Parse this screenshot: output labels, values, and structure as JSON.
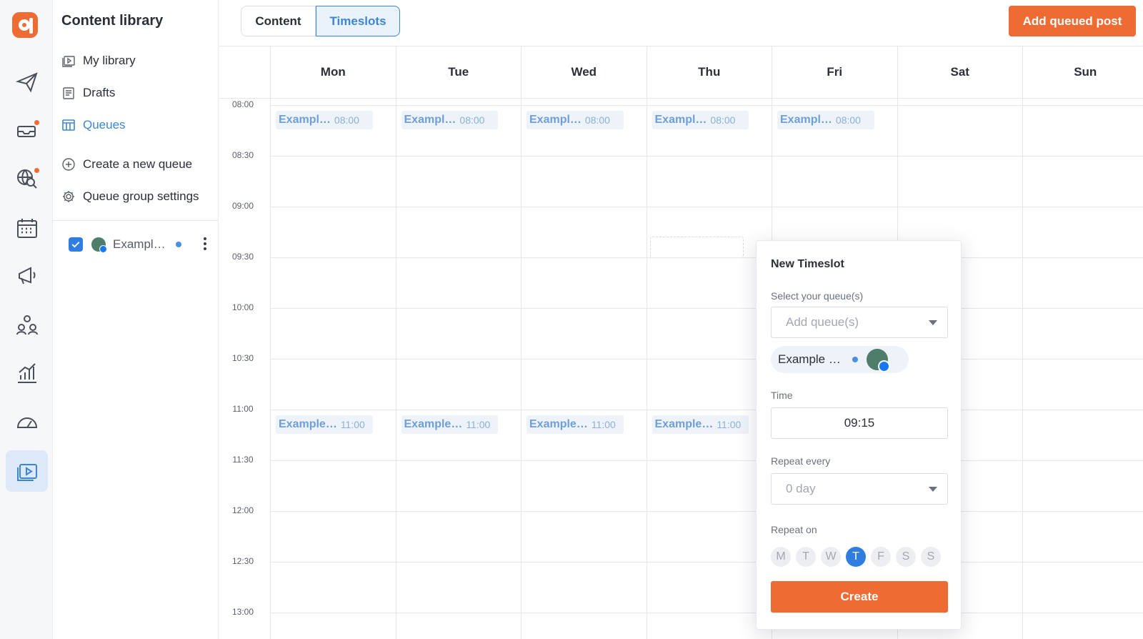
{
  "rail": {
    "icons": [
      "logo-icon",
      "paper-plane-icon",
      "inbox-icon",
      "globe-search-icon",
      "calendar-icon",
      "megaphone-icon",
      "people-icon",
      "analytics-icon",
      "speedometer-icon",
      "content-library-icon"
    ],
    "active": "content-library-icon",
    "accent": "#ee6c34"
  },
  "sidebar": {
    "title": "Content library",
    "items": [
      {
        "label": "My library",
        "icon": "library-icon"
      },
      {
        "label": "Drafts",
        "icon": "drafts-icon"
      },
      {
        "label": "Queues",
        "icon": "queues-icon",
        "active": true
      },
      {
        "label": "Create a new queue",
        "icon": "plus-circle-icon"
      },
      {
        "label": "Queue group settings",
        "icon": "gear-icon"
      }
    ],
    "queue": {
      "name": "Exampl…",
      "checked": true
    }
  },
  "topbar": {
    "tabs": [
      {
        "label": "Content",
        "active": false
      },
      {
        "label": "Timeslots",
        "active": true
      }
    ],
    "add_button": "Add queued post"
  },
  "calendar": {
    "days": [
      "Mon",
      "Tue",
      "Wed",
      "Thu",
      "Fri",
      "Sat",
      "Sun"
    ],
    "times": [
      "08:00",
      "08:30",
      "09:00",
      "09:30",
      "10:00",
      "10:30",
      "11:00",
      "11:30",
      "12:00",
      "12:30",
      "13:00"
    ],
    "events": [
      {
        "day": "Mon",
        "title": "Exampl…",
        "time": "08:00"
      },
      {
        "day": "Tue",
        "title": "Exampl…",
        "time": "08:00"
      },
      {
        "day": "Wed",
        "title": "Exampl…",
        "time": "08:00"
      },
      {
        "day": "Thu",
        "title": "Exampl…",
        "time": "08:00"
      },
      {
        "day": "Fri",
        "title": "Exampl…",
        "time": "08:00"
      },
      {
        "day": "Mon",
        "title": "Example…",
        "time": "11:00"
      },
      {
        "day": "Tue",
        "title": "Example…",
        "time": "11:00"
      },
      {
        "day": "Wed",
        "title": "Example…",
        "time": "11:00"
      },
      {
        "day": "Thu",
        "title": "Example…",
        "time": "11:00"
      }
    ]
  },
  "modal": {
    "title": "New Timeslot",
    "queue_label": "Select your queue(s)",
    "queue_placeholder": "Add queue(s)",
    "chip_name": "Example …",
    "time_label": "Time",
    "time_value": "09:15",
    "repeat_label": "Repeat every",
    "repeat_value": "0 day",
    "repeat_on_label": "Repeat on",
    "weekdays": [
      "M",
      "T",
      "W",
      "T",
      "F",
      "S",
      "S"
    ],
    "selected_weekday_index": 3,
    "create_label": "Create"
  }
}
